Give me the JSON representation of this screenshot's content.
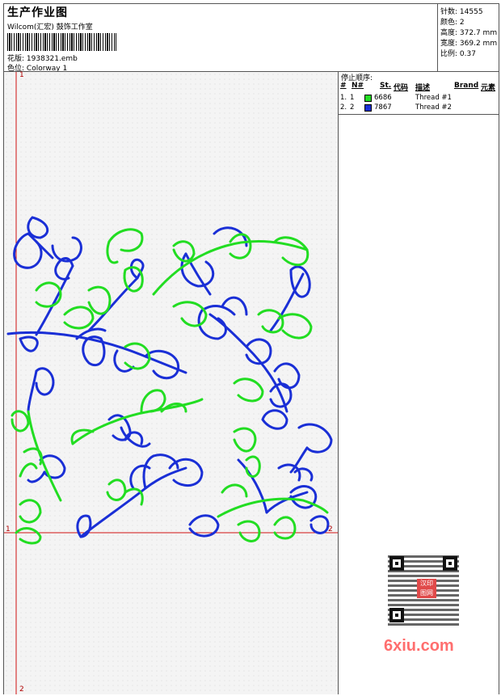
{
  "header": {
    "title": "生产作业图",
    "subtitle": "Wilcom(汇宏) 鼓饰工作室",
    "design_label": "花版:",
    "design_file": "1938321.emb",
    "colorway_label": "色位:",
    "colorway": "Colorway 1"
  },
  "stats": [
    {
      "label": "针数:",
      "value": "14555"
    },
    {
      "label": "颜色:",
      "value": "2"
    },
    {
      "label": "高度:",
      "value": "372.7 mm"
    },
    {
      "label": "宽度:",
      "value": "369.2 mm"
    },
    {
      "label": "比例:",
      "value": "0.37"
    }
  ],
  "stop_sequence": {
    "title": "停止顺序:",
    "columns": [
      "#",
      "N#",
      "St.",
      "代码",
      "描述",
      "Brand",
      "元素"
    ],
    "rows": [
      {
        "num": "1.",
        "n": "1",
        "color": "#22dd22",
        "code": "6686",
        "desc": "Thread #1"
      },
      {
        "num": "2.",
        "n": "2",
        "color": "#1a2fd6",
        "code": "7867",
        "desc": "Thread #2"
      }
    ]
  },
  "axes": {
    "top_left": "1",
    "left_mid": "1",
    "right_mid": "2",
    "bottom": "2"
  },
  "qr_stamp": "汉印\n图网",
  "watermark": "6xiu.com",
  "colors": {
    "thread1": "#22dd22",
    "thread2": "#1a2fd6",
    "guide": "#d01010"
  }
}
